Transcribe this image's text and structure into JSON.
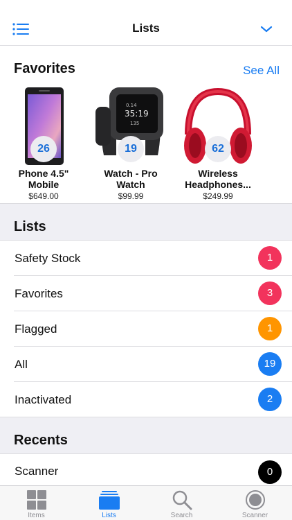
{
  "nav": {
    "title": "Lists"
  },
  "favorites": {
    "title": "Favorites",
    "see_all": "See All",
    "items": [
      {
        "name_line1": "Phone 4.5\"",
        "name_line2": "Mobile",
        "price": "$649.00",
        "count": "26"
      },
      {
        "name_line1": "Watch - Pro",
        "name_line2": "Watch",
        "price": "$99.99",
        "count": "19"
      },
      {
        "name_line1": "Wireless",
        "name_line2": "Headphones...",
        "price": "$249.99",
        "count": "62"
      }
    ]
  },
  "lists": {
    "title": "Lists",
    "items": [
      {
        "label": "Safety Stock",
        "count": "1",
        "color": "#f2335c"
      },
      {
        "label": "Favorites",
        "count": "3",
        "color": "#f2335c"
      },
      {
        "label": "Flagged",
        "count": "1",
        "color": "#ff9500"
      },
      {
        "label": "All",
        "count": "19",
        "color": "#1a7df2"
      },
      {
        "label": "Inactivated",
        "count": "2",
        "color": "#1a7df2"
      }
    ]
  },
  "recents": {
    "title": "Recents",
    "items": [
      {
        "label": "Scanner",
        "count": "0",
        "color": "#000000"
      }
    ]
  },
  "tabs": [
    {
      "label": "Items",
      "icon": "grid-icon"
    },
    {
      "label": "Lists",
      "icon": "stack-icon",
      "active": true
    },
    {
      "label": "Search",
      "icon": "search-icon"
    },
    {
      "label": "Scanner",
      "icon": "scanner-icon"
    }
  ],
  "colors": {
    "accent": "#1a7df2",
    "background_gray": "#efeff4"
  }
}
